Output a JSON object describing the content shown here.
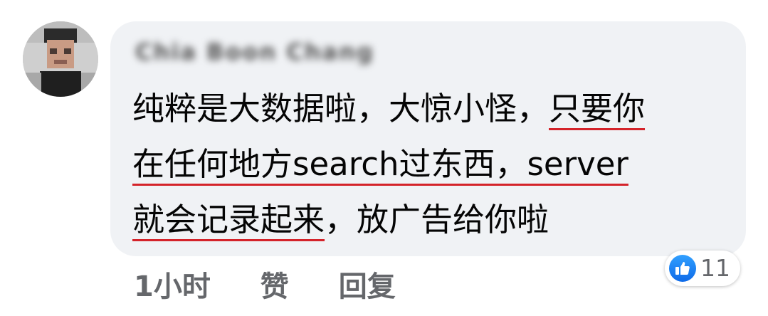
{
  "comment": {
    "author": "Chia Boon Chang",
    "lines": [
      [
        {
          "text": "纯粹是大数据啦，大惊小怪，",
          "underline": false
        },
        {
          "text": "只要你",
          "underline": true
        }
      ],
      [
        {
          "text": "在任何地方search过东西，server",
          "underline": true
        }
      ],
      [
        {
          "text": "就会记录起来",
          "underline": true
        },
        {
          "text": "，放广告给你啦",
          "underline": false
        }
      ]
    ],
    "time": "1小时",
    "like_label": "赞",
    "reply_label": "回复",
    "reactions": {
      "icon": "thumbs-up-icon",
      "count": "11",
      "color": "#1877f2"
    },
    "colors": {
      "bubble": "#f0f2f5",
      "underline": "#d4232a",
      "meta": "#65676b"
    }
  }
}
